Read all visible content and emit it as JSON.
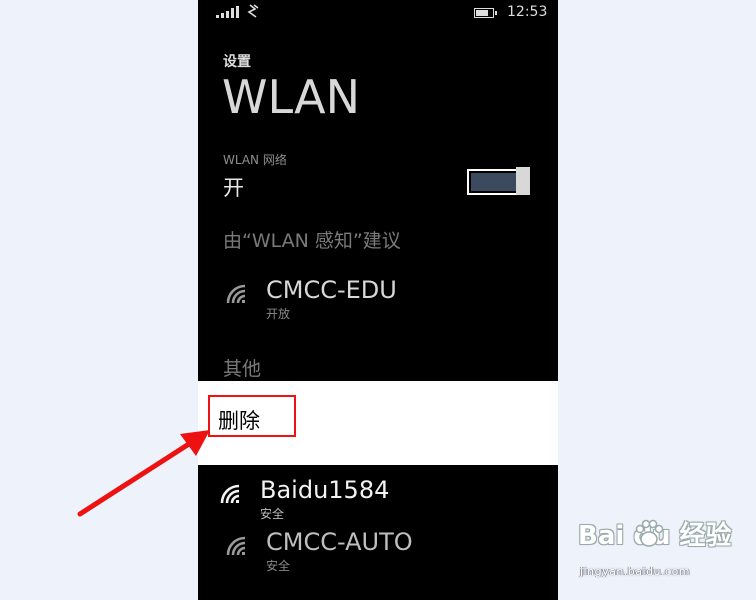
{
  "status_bar": {
    "time": "12:53",
    "icons": [
      "signal-icon",
      "data-icon",
      "battery-icon"
    ]
  },
  "header": {
    "subtitle": "设置",
    "title": "WLAN"
  },
  "wlan_toggle": {
    "label": "WLAN 网络",
    "state": "开",
    "on": true,
    "accent": "#3b4a5f"
  },
  "sections": {
    "suggested_header": "由“WLAN 感知”建议",
    "other_header": "其他"
  },
  "networks": {
    "suggested": [
      {
        "name": "CMCC-EDU",
        "status": "开放"
      }
    ],
    "other": [
      {
        "name": "Baidu1584",
        "status": "安全"
      },
      {
        "name": "CMCC-AUTO",
        "status": "安全"
      }
    ]
  },
  "context_menu": {
    "items": [
      {
        "label": "删除"
      }
    ],
    "highlight_color": "#ee1111"
  },
  "annotation": {
    "arrow_color": "#ee1111"
  },
  "watermark": {
    "logo": "Bai  du 经验",
    "url": "jingyan.baidu.com"
  }
}
